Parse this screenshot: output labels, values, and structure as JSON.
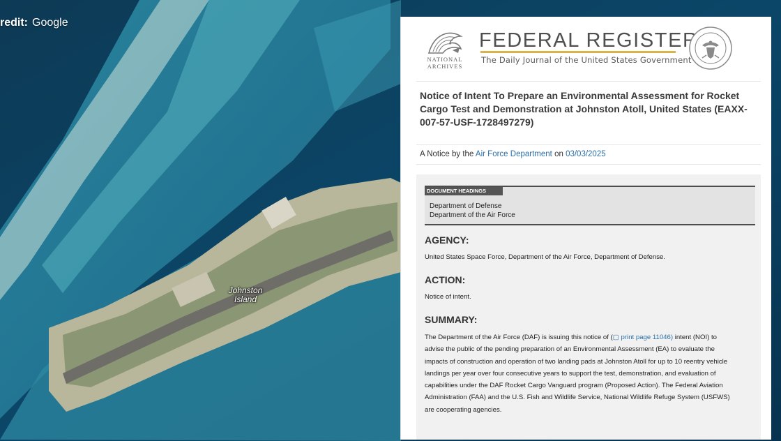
{
  "map": {
    "credit_label": "redit:",
    "credit_source": "Google",
    "place_label_line1": "Johnston",
    "place_label_line2": "Island"
  },
  "header": {
    "archives_line1": "NATIONAL",
    "archives_line2": "ARCHIVES",
    "title": "FEDERAL REGISTER",
    "subtitle": "The Daily Journal of the United States Government",
    "seal_icon": "national-archives-seal-icon",
    "logo_icon": "eagle-logo-icon"
  },
  "document": {
    "title_line1": "Notice of Intent To Prepare an Environmental Assessment for Rocket",
    "title_line2": "Cargo Test and Demonstration at Johnston Atoll, United States (EAXX-",
    "title_line3": "007-57-USF-1728497279)",
    "byline_prefix": "A Notice by the",
    "byline_agency": "Air Force Department",
    "byline_on": "on",
    "byline_date": "03/03/2025",
    "headings_tag": "DOCUMENT HEADINGS",
    "headings": [
      "Department of Defense",
      "Department of the Air Force"
    ],
    "agency_heading": "AGENCY:",
    "agency_text": "United States Space Force, Department of the Air Force, Department of Defense.",
    "action_heading": "ACTION:",
    "action_text": "Notice of intent.",
    "summary_heading": "SUMMARY:",
    "summary_line1_a": "The Department of the Air Force (DAF) is issuing this notice of (",
    "summary_print_page": "▢ print page 11046)",
    "summary_line1_b": " intent (NOI) to",
    "summary_lines": [
      "advise the public of the pending preparation of an Environmental Assessment (EA) to evaluate the",
      "impacts of construction and operation of two landing pads at Johnston Atoll for up to 10 reentry vehicle",
      "landings per year over four consecutive years to support the test, demonstration, and evaluation of",
      "capabilities under the DAF Rocket Cargo Vanguard program (Proposed Action). The Federal Aviation",
      "Administration (FAA) and the U.S. Fish and Wildlife Service, National Wildlife Refuge System (USFWS)",
      "are cooperating agencies."
    ]
  },
  "colors": {
    "link": "#2c6ea5",
    "accent_line": "#d9b34b",
    "ocean_deep": "#0a3f5e",
    "reef": "#3fa9b8"
  }
}
